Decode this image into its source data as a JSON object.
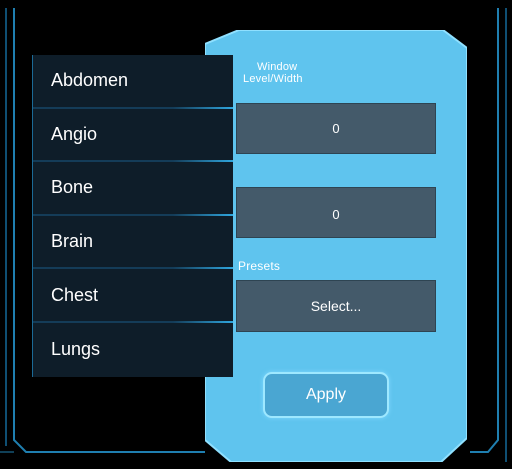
{
  "presets": {
    "items": [
      {
        "label": "Abdomen"
      },
      {
        "label": "Angio"
      },
      {
        "label": "Bone"
      },
      {
        "label": "Brain"
      },
      {
        "label": "Chest"
      },
      {
        "label": "Lungs"
      }
    ]
  },
  "window_panel": {
    "title_line1": "Window",
    "title_line2": "Level/Width",
    "level_value": "0",
    "width_value": "0",
    "presets_label": "Presets",
    "select_value": "Select...",
    "apply_label": "Apply"
  },
  "colors": {
    "panel": "#5fc4ee",
    "accent": "#2fa6de",
    "field": "#445a6a",
    "list_bg": "#0e1d29"
  }
}
